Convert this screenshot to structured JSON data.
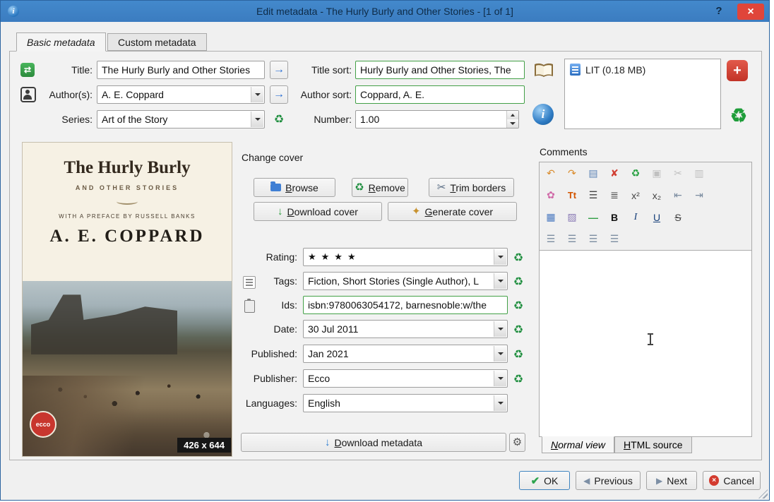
{
  "window": {
    "title": "Edit metadata - The Hurly Burly and Other Stories - [1 of 1]",
    "help": "?",
    "close": "×"
  },
  "tabs": {
    "basic": "Basic metadata",
    "custom": "Custom metadata"
  },
  "fields": {
    "title": {
      "label": "Title:",
      "value": "The Hurly Burly and Other Stories"
    },
    "title_sort": {
      "label": "Title sort:",
      "value": "Hurly Burly and Other Stories, The"
    },
    "authors": {
      "label": "Author(s):",
      "value": "A. E. Coppard"
    },
    "author_sort": {
      "label": "Author sort:",
      "value": "Coppard, A. E."
    },
    "series": {
      "label": "Series:",
      "value": "Art of the Story"
    },
    "number": {
      "label": "Number:",
      "value": "1.00"
    },
    "rating": {
      "label": "Rating:",
      "value": "★★★★"
    },
    "tags": {
      "label": "Tags:",
      "value": "Fiction, Short Stories (Single Author), L"
    },
    "ids": {
      "label": "Ids:",
      "value": "isbn:9780063054172, barnesnoble:w/the"
    },
    "date": {
      "label": "Date:",
      "value": "30 Jul 2011"
    },
    "published": {
      "label": "Published:",
      "value": "Jan 2021"
    },
    "publisher": {
      "label": "Publisher:",
      "value": "Ecco"
    },
    "languages": {
      "label": "Languages:",
      "value": "English"
    }
  },
  "formats": {
    "items": [
      {
        "label": "LIT (0.18 MB)"
      }
    ]
  },
  "cover": {
    "title": "The Hurly Burly",
    "subtitle": "AND OTHER STORIES",
    "preface": "WITH A PREFACE BY RUSSELL BANKS",
    "author": "A. E. COPPARD",
    "badge": "426 x 644",
    "sticker": "ecco"
  },
  "change_cover": {
    "title": "Change cover",
    "browse": "Browse",
    "remove": "Remove",
    "trim": "Trim borders",
    "download": "Download cover",
    "generate": "Generate cover"
  },
  "download_metadata": {
    "label": "Download metadata"
  },
  "comments": {
    "label": "Comments",
    "tabs": {
      "normal": "Normal view",
      "html": "HTML source"
    },
    "toolbar": {
      "r1": [
        "↶",
        "↷",
        "▤",
        "✘",
        "♻",
        "▣",
        "✂",
        "▥"
      ],
      "r2": [
        "✿",
        "Tt",
        "☰",
        "≣",
        "x²",
        "x₂",
        "⇤",
        "⇥"
      ],
      "r3": [
        "▦",
        "▨",
        "—",
        "B",
        "I",
        "U",
        "S"
      ],
      "r4": [
        "☰",
        "☰",
        "☰",
        "☰"
      ]
    }
  },
  "footer": {
    "ok": "OK",
    "previous": "Previous",
    "next": "Next",
    "cancel": "Cancel"
  },
  "icons": {
    "ok": "✔",
    "previous": "◀",
    "next": "▶",
    "cancel_x": "×",
    "arrow": "→",
    "recycle": "♻",
    "scissors": "✂",
    "down": "↓",
    "sparkle": "✦",
    "gear": "⚙",
    "plus": "+",
    "info": "i",
    "swap": "⇄"
  },
  "colors": {
    "titlebar": "#3d80c4",
    "close_button": "#e0453a",
    "green_border": "#43a047",
    "recycle_green": "#1e8e3e",
    "accent_blue": "#2d6fc0",
    "star": "#222222"
  }
}
